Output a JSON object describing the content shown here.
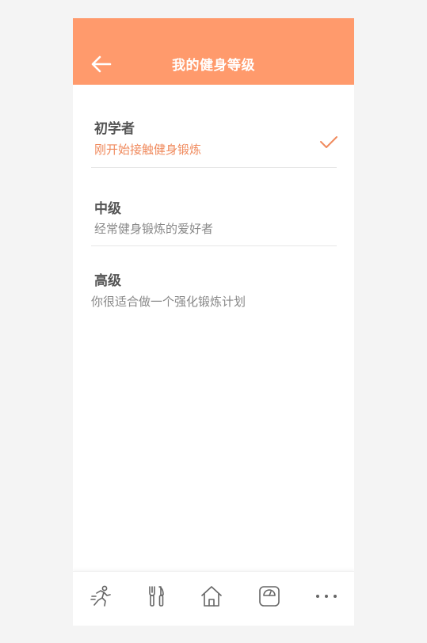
{
  "header": {
    "title": "我的健身等级"
  },
  "levels": [
    {
      "name": "初学者",
      "description": "刚开始接触健身锻炼",
      "selected": true
    },
    {
      "name": "中级",
      "description": "经常健身锻炼的爱好者",
      "selected": false
    },
    {
      "name": "高级",
      "description": "你很适合做一个强化锻炼计划",
      "selected": false
    }
  ],
  "tabbar": {
    "items": [
      {
        "icon": "running-icon"
      },
      {
        "icon": "fork-knife-icon"
      },
      {
        "icon": "home-icon"
      },
      {
        "icon": "scale-icon"
      },
      {
        "icon": "more-icon"
      }
    ]
  },
  "colors": {
    "header_bg": "#ff9a6c",
    "accent": "#f08a5d",
    "text_primary": "#555555",
    "text_secondary": "#888888"
  }
}
